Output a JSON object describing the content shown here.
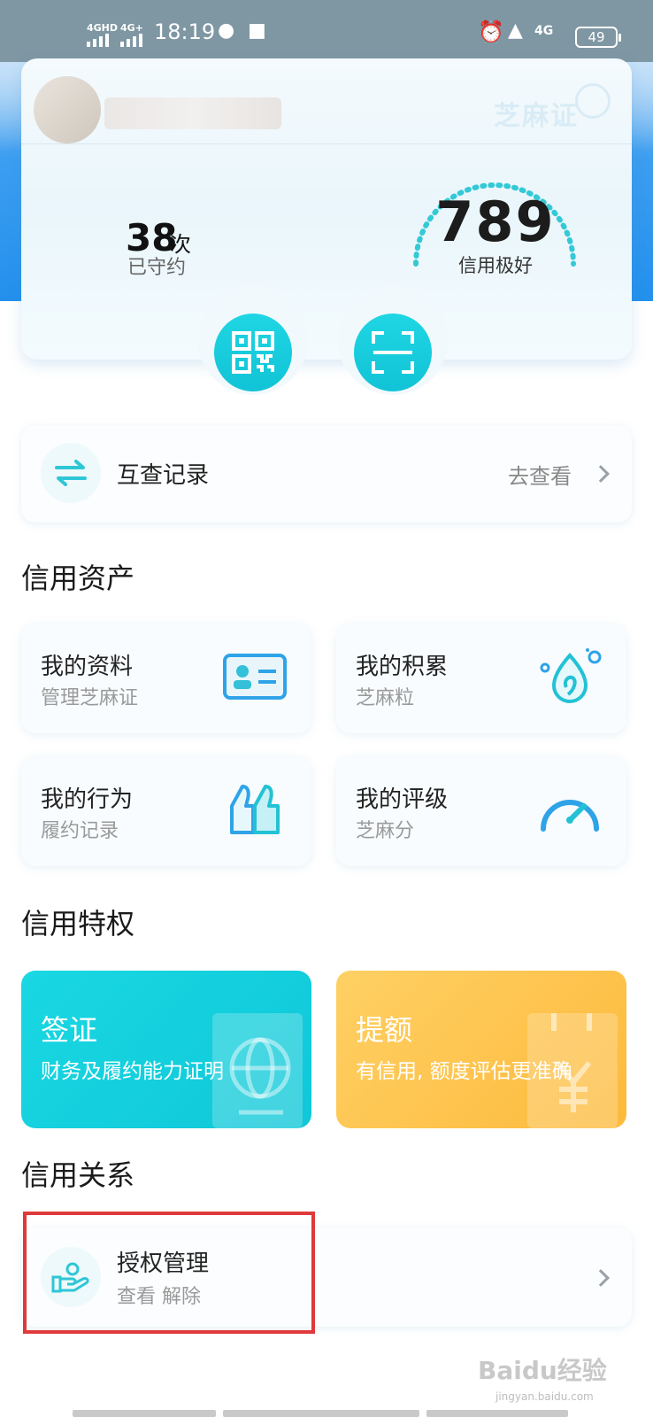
{
  "status_bar": {
    "network1": "4GHD",
    "network2": "4G+",
    "time": "18:19",
    "network3": "4G",
    "battery": "49",
    "icons": [
      "wechat-icon",
      "dnd-app-icon",
      "alarm-icon",
      "mute-bell-icon"
    ]
  },
  "credit_card": {
    "kept_count": "38",
    "kept_unit": "次",
    "kept_label": "已守约",
    "score": "789",
    "score_label": "信用极好",
    "brand_watermark": "芝麻证",
    "buttons": [
      "qr-code-icon",
      "scan-icon"
    ]
  },
  "mutual_check": {
    "title": "互查记录",
    "action": "去查看"
  },
  "credit_assets": {
    "section_title": "信用资产",
    "tiles": [
      {
        "title": "我的资料",
        "sub": "管理芝麻证",
        "icon": "id-card-icon"
      },
      {
        "title": "我的积累",
        "sub": "芝麻粒",
        "icon": "sesame-drop-icon"
      },
      {
        "title": "我的行为",
        "sub": "履约记录",
        "icon": "thumbs-up-icon"
      },
      {
        "title": "我的评级",
        "sub": "芝麻分",
        "icon": "gauge-icon"
      }
    ]
  },
  "credit_privileges": {
    "section_title": "信用特权",
    "cards": [
      {
        "title": "签证",
        "sub": "财务及履约能力证明",
        "color": "#1ed4e1"
      },
      {
        "title": "提额",
        "sub": "有信用, 额度评估更准确",
        "color": "#fdc34d"
      }
    ]
  },
  "credit_relations": {
    "section_title": "信用关系",
    "auth": {
      "title": "授权管理",
      "sub": "查看 解除"
    }
  },
  "watermark": {
    "text": "Baidu经验",
    "sub": "jingyan.baidu.com"
  },
  "colors": {
    "accent": "#13c6d8",
    "header_blue": "#2390ed",
    "highlight": "#e0393c"
  }
}
